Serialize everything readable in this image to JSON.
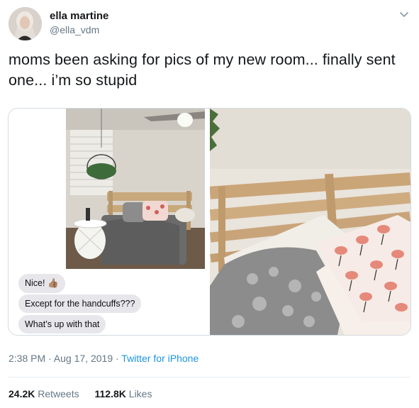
{
  "user": {
    "display_name": "ella martine",
    "handle": "@ella_vdm"
  },
  "tweet": {
    "text": "moms been asking for pics of my new room... finally sent one... i’m so stupid"
  },
  "media": {
    "messages": [
      "Nice! 👍🏽",
      "Except for the handcuffs???",
      "What’s up with that"
    ]
  },
  "meta": {
    "time": "2:38 PM · Aug 17, 2019 · ",
    "source": "Twitter for iPhone"
  },
  "stats": {
    "retweets_count": "24.2K",
    "retweets_label": "Retweets",
    "likes_count": "112.8K",
    "likes_label": "Likes"
  },
  "icons": {
    "menu": "chevron-down-icon"
  }
}
